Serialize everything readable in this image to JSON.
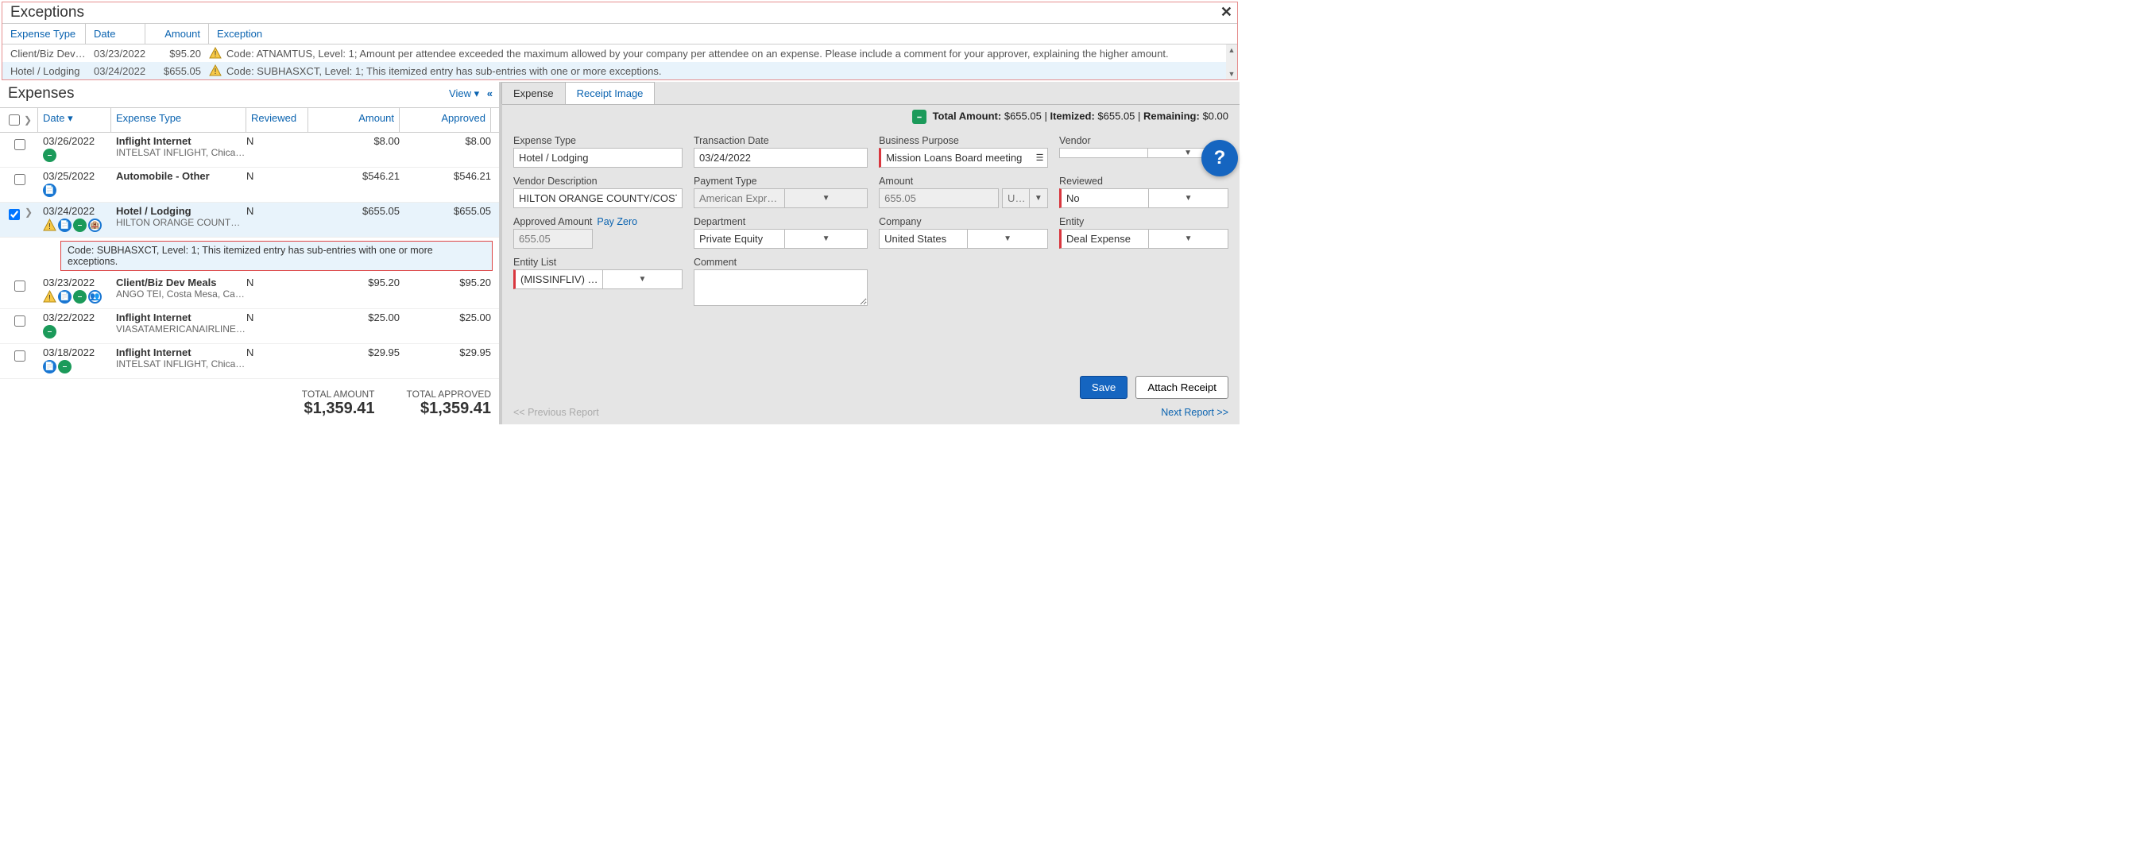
{
  "exceptions": {
    "title": "Exceptions",
    "columns": {
      "type": "Expense Type",
      "date": "Date",
      "amount": "Amount",
      "exc": "Exception"
    },
    "rows": [
      {
        "type": "Client/Biz Dev …",
        "date": "03/23/2022",
        "amount": "$95.20",
        "msg": "Code: ATNAMTUS, Level: 1; Amount per attendee exceeded the maximum allowed by your company per attendee on an expense. Please include a comment for your approver, explaining the higher amount."
      },
      {
        "type": "Hotel / Lodging",
        "date": "03/24/2022",
        "amount": "$655.05",
        "msg": "Code: SUBHASXCT, Level: 1; This itemized entry has sub-entries with one or more exceptions."
      }
    ]
  },
  "expenses": {
    "title": "Expenses",
    "view_label": "View ▾",
    "columns": {
      "date": "Date ▾",
      "type": "Expense Type",
      "reviewed": "Reviewed",
      "amount": "Amount",
      "approved": "Approved"
    },
    "rows": [
      {
        "date": "03/26/2022",
        "type": "Inflight Internet",
        "sub": "INTELSAT INFLIGHT, Chicago,",
        "reviewed": "N",
        "amount": "$8.00",
        "approved": "$8.00"
      },
      {
        "date": "03/25/2022",
        "type": "Automobile - Other",
        "sub": "",
        "reviewed": "N",
        "amount": "$546.21",
        "approved": "$546.21"
      },
      {
        "date": "03/24/2022",
        "type": "Hotel / Lodging",
        "sub": "HILTON ORANGE COUNTY/CO",
        "reviewed": "N",
        "amount": "$655.05",
        "approved": "$655.05",
        "exception": "Code: SUBHASXCT, Level: 1; This itemized entry has sub-entries with one or more exceptions."
      },
      {
        "date": "03/23/2022",
        "type": "Client/Biz Dev Meals",
        "sub": "ANGO TEI, Costa Mesa, Califor",
        "reviewed": "N",
        "amount": "$95.20",
        "approved": "$95.20"
      },
      {
        "date": "03/22/2022",
        "type": "Inflight Internet",
        "sub": "VIASATAMERICANAIRLINES, C",
        "reviewed": "N",
        "amount": "$25.00",
        "approved": "$25.00"
      },
      {
        "date": "03/18/2022",
        "type": "Inflight Internet",
        "sub": "INTELSAT INFLIGHT, Chicago,",
        "reviewed": "N",
        "amount": "$29.95",
        "approved": "$29.95"
      }
    ],
    "totals": {
      "amount_label": "TOTAL AMOUNT",
      "amount": "$1,359.41",
      "approved_label": "TOTAL APPROVED",
      "approved": "$1,359.41"
    }
  },
  "detail": {
    "tabs": {
      "expense": "Expense",
      "receipt": "Receipt Image"
    },
    "summary": {
      "total_l": "Total Amount:",
      "total_v": "$655.05",
      "item_l": "Itemized:",
      "item_v": "$655.05",
      "rem_l": "Remaining:",
      "rem_v": "$0.00"
    },
    "labels": {
      "expense_type": "Expense Type",
      "transaction_date": "Transaction Date",
      "business_purpose": "Business Purpose",
      "vendor": "Vendor",
      "vendor_desc": "Vendor Description",
      "payment_type": "Payment Type",
      "amount": "Amount",
      "reviewed": "Reviewed",
      "approved_amount": "Approved Amount",
      "pay_zero": "Pay Zero",
      "department": "Department",
      "company": "Company",
      "entity": "Entity",
      "entity_list": "Entity List",
      "comment": "Comment"
    },
    "values": {
      "expense_type": "Hotel / Lodging",
      "transaction_date": "03/24/2022",
      "business_purpose": "Mission Loans Board meeting",
      "vendor": "",
      "vendor_desc": "HILTON ORANGE COUNTY/COST",
      "payment_type": "American Express Corporate Ca",
      "amount": "655.05",
      "currency": "USD",
      "reviewed": "No",
      "approved_amount": "655.05",
      "department": "Private Equity",
      "company": "United States",
      "entity": "Deal Expense",
      "entity_list": "(MISSINFLIV) Mission Loans",
      "comment": ""
    },
    "actions": {
      "save": "Save",
      "attach": "Attach Receipt"
    },
    "nav": {
      "prev": "<< Previous Report",
      "next": "Next Report >>"
    }
  }
}
